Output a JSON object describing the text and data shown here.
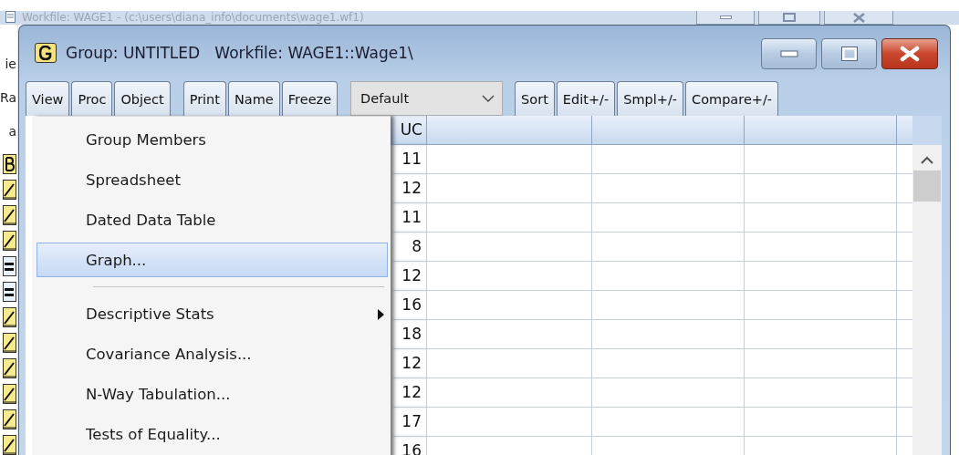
{
  "parent_window": {
    "title": "Workfile: WAGE1 - (c:\\users\\diana_info\\documents\\wage1.wf1)"
  },
  "workfile_list": {
    "labels": [
      "ie",
      "Ra",
      "a"
    ],
    "objects": [
      {
        "kind": "coef"
      },
      {
        "kind": "series"
      },
      {
        "kind": "series"
      },
      {
        "kind": "series"
      },
      {
        "kind": "equation"
      },
      {
        "kind": "equation"
      },
      {
        "kind": "series"
      },
      {
        "kind": "series"
      },
      {
        "kind": "series"
      },
      {
        "kind": "series"
      },
      {
        "kind": "series"
      },
      {
        "kind": "series"
      }
    ]
  },
  "window": {
    "title": "Group: UNTITLED   Workfile: WAGE1::Wage1\\"
  },
  "toolbar": {
    "groups": [
      [
        "View",
        "Proc",
        "Object"
      ],
      [
        "Print",
        "Name",
        "Freeze"
      ]
    ],
    "dropdown": {
      "value": "Default"
    },
    "buttons": [
      "Sort",
      "Edit+/-",
      "Smpl+/-",
      "Compare+/-"
    ]
  },
  "grid": {
    "header": "UC",
    "values": [
      "11",
      "12",
      "11",
      "8",
      "12",
      "16",
      "18",
      "12",
      "12",
      "17",
      "16"
    ]
  },
  "view_menu": {
    "items": [
      {
        "kind": "item",
        "label": "Group Members",
        "selected": false
      },
      {
        "kind": "item",
        "label": "Spreadsheet",
        "selected": false
      },
      {
        "kind": "item",
        "label": "Dated Data Table",
        "selected": false
      },
      {
        "kind": "item",
        "label": "Graph...",
        "selected": true
      },
      {
        "kind": "separator"
      },
      {
        "kind": "submenu",
        "label": "Descriptive Stats",
        "selected": false
      },
      {
        "kind": "item",
        "label": "Covariance Analysis...",
        "selected": false
      },
      {
        "kind": "item",
        "label": "N-Way Tabulation...",
        "selected": false
      },
      {
        "kind": "item",
        "label": "Tests of Equality...",
        "selected": false
      }
    ]
  }
}
